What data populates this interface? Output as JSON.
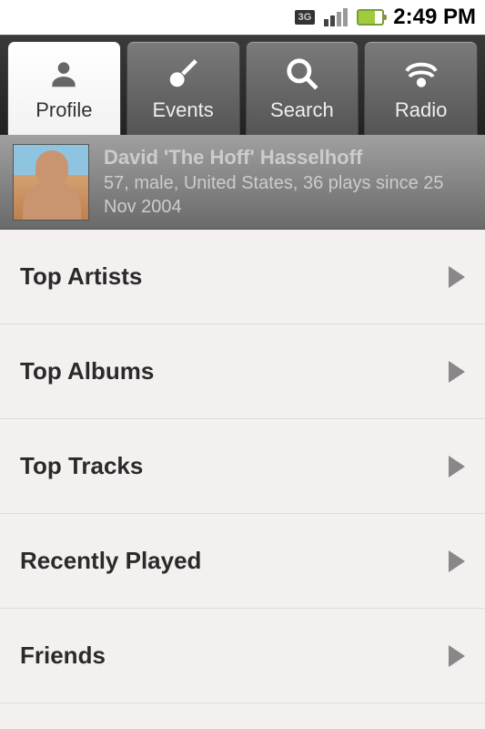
{
  "status": {
    "time": "2:49 PM"
  },
  "tabs": [
    {
      "label": "Profile",
      "active": true
    },
    {
      "label": "Events",
      "active": false
    },
    {
      "label": "Search",
      "active": false
    },
    {
      "label": "Radio",
      "active": false
    }
  ],
  "profile": {
    "name": "David 'The Hoff' Hasselhoff",
    "subtitle": "57, male, United States, 36 plays since 25 Nov 2004"
  },
  "menu": [
    {
      "label": "Top Artists"
    },
    {
      "label": "Top Albums"
    },
    {
      "label": "Top Tracks"
    },
    {
      "label": "Recently Played"
    },
    {
      "label": "Friends"
    }
  ]
}
